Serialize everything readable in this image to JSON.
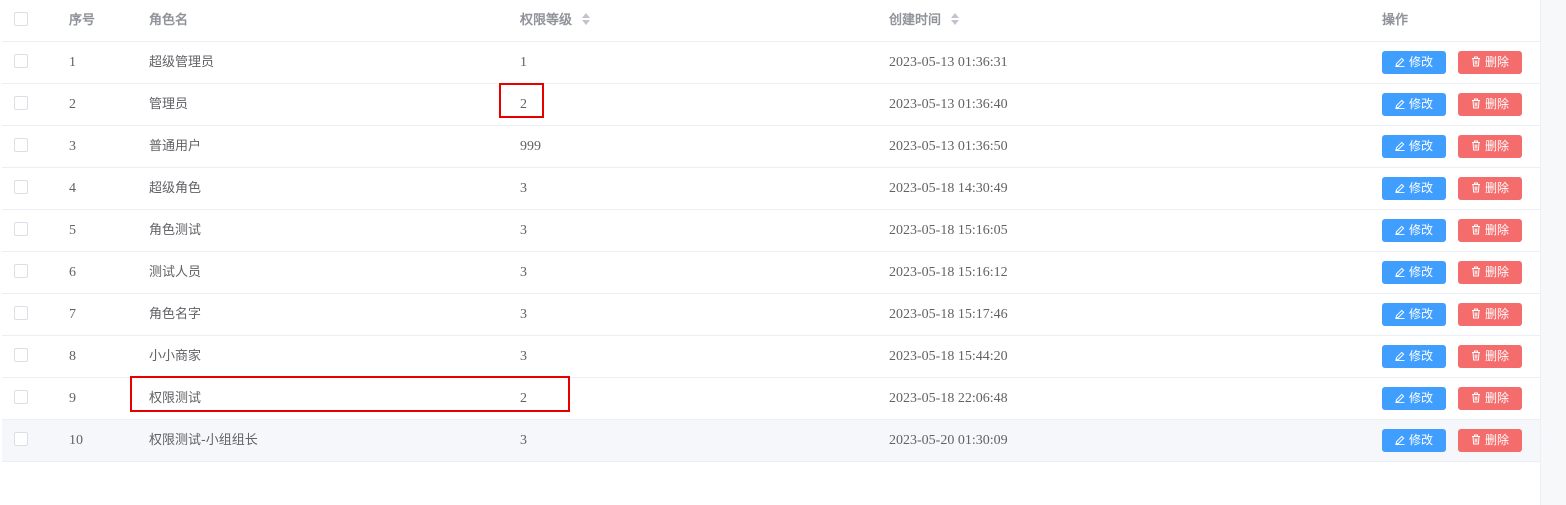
{
  "table": {
    "headers": {
      "index": "序号",
      "name": "角色名",
      "level": "权限等级",
      "created": "创建时间",
      "actions": "操作"
    },
    "rows": [
      {
        "index": "1",
        "name": "超级管理员",
        "level": "1",
        "created": "2023-05-13 01:36:31"
      },
      {
        "index": "2",
        "name": "管理员",
        "level": "2",
        "created": "2023-05-13 01:36:40"
      },
      {
        "index": "3",
        "name": "普通用户",
        "level": "999",
        "created": "2023-05-13 01:36:50"
      },
      {
        "index": "4",
        "name": "超级角色",
        "level": "3",
        "created": "2023-05-18 14:30:49"
      },
      {
        "index": "5",
        "name": "角色测试",
        "level": "3",
        "created": "2023-05-18 15:16:05"
      },
      {
        "index": "6",
        "name": "测试人员",
        "level": "3",
        "created": "2023-05-18 15:16:12"
      },
      {
        "index": "7",
        "name": "角色名字",
        "level": "3",
        "created": "2023-05-18 15:17:46"
      },
      {
        "index": "8",
        "name": "小小商家",
        "level": "3",
        "created": "2023-05-18 15:44:20"
      },
      {
        "index": "9",
        "name": "权限测试",
        "level": "2",
        "created": "2023-05-18 22:06:48"
      },
      {
        "index": "10",
        "name": "权限测试-小组组长",
        "level": "3",
        "created": "2023-05-20 01:30:09"
      }
    ],
    "edit_label": "修改",
    "delete_label": "删除"
  },
  "colors": {
    "edit_button": "#409eff",
    "delete_button": "#f56c6c",
    "highlight_box": "#e60000",
    "hover_row": "#f5f7fa"
  },
  "icons": {
    "edit": "edit-icon",
    "delete": "trash-icon",
    "sort": "sort-caret-icon"
  }
}
